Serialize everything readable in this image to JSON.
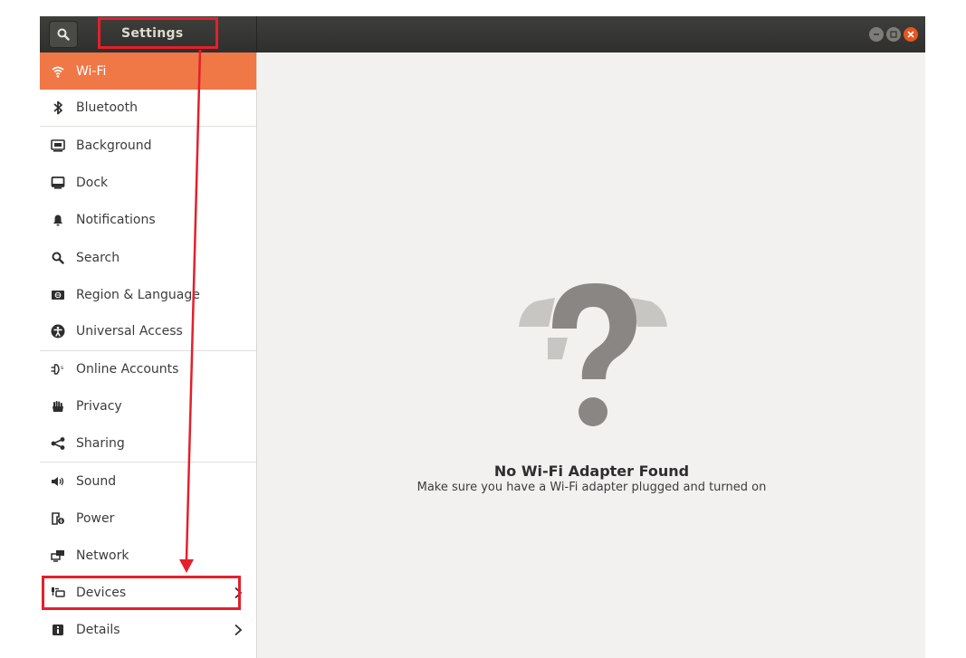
{
  "app": {
    "title": "Settings"
  },
  "sidebar": {
    "items": [
      {
        "label": "Wi-Fi",
        "icon": "wifi-icon",
        "active": true
      },
      {
        "label": "Bluetooth",
        "icon": "bluetooth-icon"
      },
      {
        "label": "Background",
        "icon": "background-icon"
      },
      {
        "label": "Dock",
        "icon": "dock-icon"
      },
      {
        "label": "Notifications",
        "icon": "bell-icon"
      },
      {
        "label": "Search",
        "icon": "search-icon"
      },
      {
        "label": "Region & Language",
        "icon": "region-icon"
      },
      {
        "label": "Universal Access",
        "icon": "accessibility-icon"
      },
      {
        "label": "Online Accounts",
        "icon": "online-accounts-icon"
      },
      {
        "label": "Privacy",
        "icon": "hand-icon"
      },
      {
        "label": "Sharing",
        "icon": "share-icon"
      },
      {
        "label": "Sound",
        "icon": "speaker-icon"
      },
      {
        "label": "Power",
        "icon": "power-icon"
      },
      {
        "label": "Network",
        "icon": "network-icon"
      },
      {
        "label": "Devices",
        "icon": "devices-icon"
      },
      {
        "label": "Details",
        "icon": "info-icon"
      }
    ]
  },
  "main": {
    "empty_state": {
      "icon": "question-mark-icon",
      "title": "No Wi-Fi Adapter Found",
      "subtitle": "Make sure you have a Wi-Fi adapter plugged and turned on"
    }
  },
  "colors": {
    "accent": "#f07746",
    "titlebar": "#3a3a37",
    "annotation": "#e3202c"
  }
}
